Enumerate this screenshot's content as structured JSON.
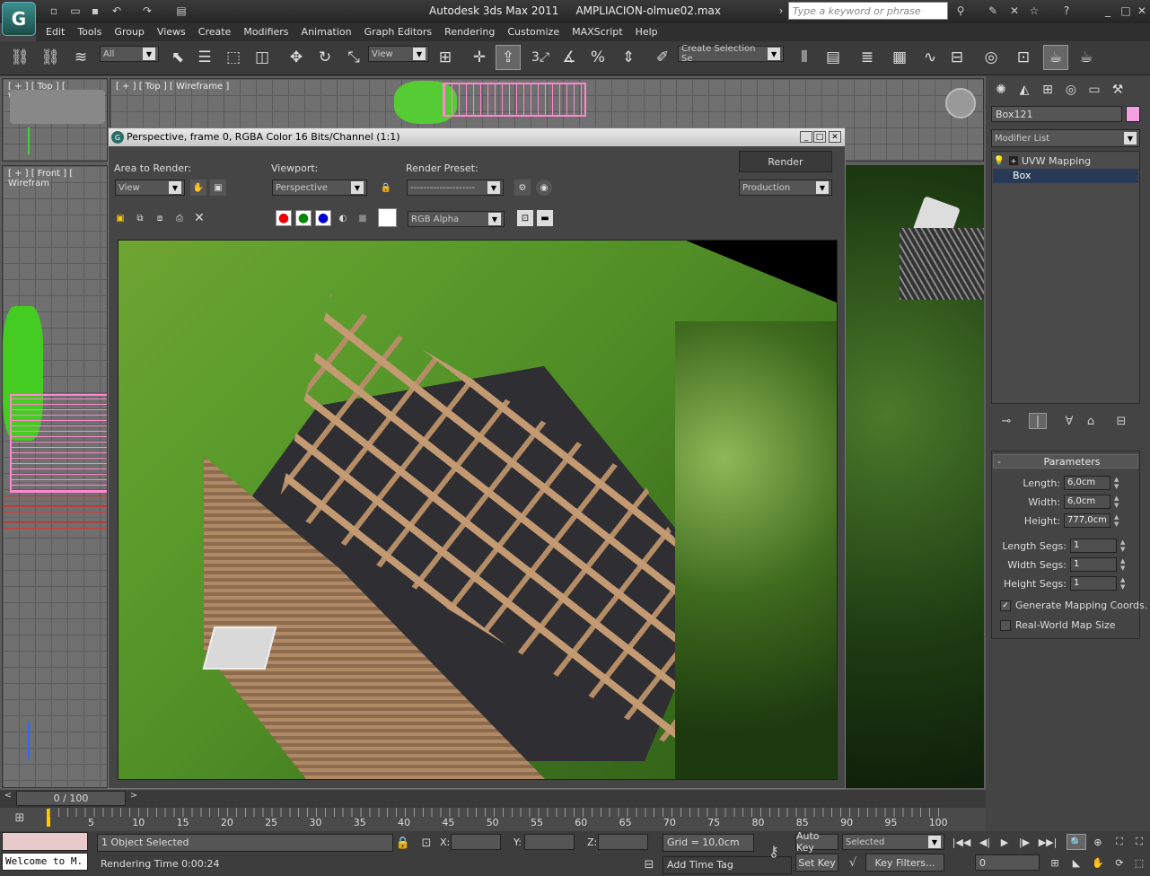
{
  "app": {
    "title": "Autodesk 3ds Max  2011",
    "file": "AMPLIACION-olmue02.max",
    "logo_glyph": "G"
  },
  "search": {
    "placeholder": "Type a keyword or phrase"
  },
  "menu": [
    "Edit",
    "Tools",
    "Group",
    "Views",
    "Create",
    "Modifiers",
    "Animation",
    "Graph Editors",
    "Rendering",
    "Customize",
    "MAXScript",
    "Help"
  ],
  "toolbar": {
    "filter": "All",
    "coord": "View",
    "selection_set": "Create Selection Se",
    "snap_label": "3"
  },
  "viewports": {
    "top_left": "[ + ] [ Top ] [ Wireframe ]",
    "top_right": "[ + ] [ Top ] [ Wireframe ]",
    "front": "[ + ] [ Front ] [ Wirefram"
  },
  "render_dialog": {
    "title": "Perspective, frame 0, RGBA Color 16 Bits/Channel (1:1)",
    "area_label": "Area to Render:",
    "area_value": "View",
    "viewport_label": "Viewport:",
    "viewport_value": "Perspective",
    "preset_label": "Render Preset:",
    "preset_value": "--------------------",
    "render_button": "Render",
    "production_value": "Production",
    "channel_value": "RGB Alpha"
  },
  "command_panel": {
    "object_name": "Box121",
    "object_color": "#f2a0e0",
    "modifier_list": "Modifier List",
    "stack": [
      {
        "label": "UVW Mapping"
      },
      {
        "label": "Box"
      }
    ],
    "rollout_title": "Parameters",
    "params": [
      {
        "label": "Length:",
        "value": "6,0cm"
      },
      {
        "label": "Width:",
        "value": "6,0cm"
      },
      {
        "label": "Height:",
        "value": "777,0cm"
      },
      {
        "label": "Length Segs:",
        "value": "1"
      },
      {
        "label": "Width Segs:",
        "value": "1"
      },
      {
        "label": "Height Segs:",
        "value": "1"
      }
    ],
    "gen_mapping": "Generate Mapping Coords.",
    "real_world": "Real-World Map Size"
  },
  "timeline": {
    "frame": "0 / 100",
    "ticks": [
      "5",
      "10",
      "15",
      "20",
      "25",
      "30",
      "35",
      "40",
      "45",
      "50",
      "55",
      "60",
      "65",
      "70",
      "75",
      "80",
      "85",
      "90",
      "95",
      "100"
    ]
  },
  "status": {
    "maxscript": "Welcome to M.",
    "selected": "1 Object Selected",
    "render_time": "Rendering Time  0:00:24",
    "x_label": "X:",
    "y_label": "Y:",
    "z_label": "Z:",
    "grid": "Grid = 10,0cm",
    "add_time_tag": "Add Time Tag",
    "auto_key": "Auto Key",
    "set_key": "Set Key",
    "key_mode": "Selected",
    "key_filters": "Key Filters...",
    "frame_field": "0"
  }
}
